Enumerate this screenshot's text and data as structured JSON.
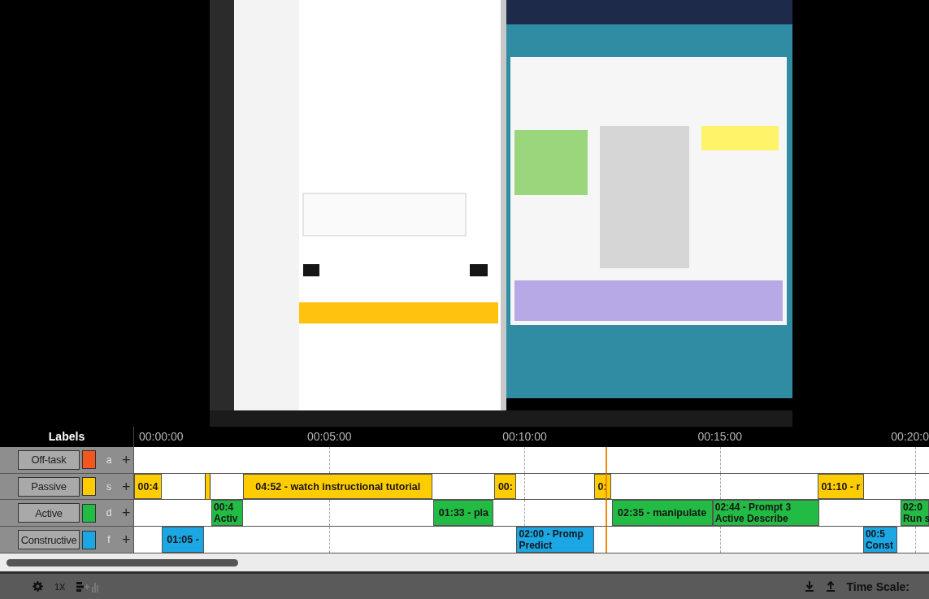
{
  "timeline": {
    "labels_header": "Labels",
    "ticks": [
      "00:00:00",
      "00:05:00",
      "00:10:00",
      "00:15:00",
      "00:20:0"
    ]
  },
  "tracks": [
    {
      "label": "Off-task",
      "color": "#f4561e",
      "key": "a",
      "add": "+"
    },
    {
      "label": "Passive",
      "color": "#ffcc00",
      "key": "s",
      "add": "+",
      "segments": [
        {
          "text": "00:4"
        },
        {
          "kind": "blank"
        },
        {
          "text": "04:52 - watch instructional tutorial"
        },
        {
          "text": "00:"
        },
        {
          "text": "0:"
        },
        {
          "text": "01:10 - r"
        }
      ]
    },
    {
      "label": "Active",
      "color": "#22bb44",
      "key": "d",
      "add": "+",
      "segments": [
        {
          "text": "00:4",
          "text_2": "Activ"
        },
        {
          "text": "01:33 - pla"
        },
        {
          "text": "02:35 - manipulate"
        },
        {
          "text": "02:44 - Prompt 3",
          "text_2": "Active Describe"
        },
        {
          "text": "02:0",
          "text_2": "Run s"
        }
      ]
    },
    {
      "label": "Constructive",
      "color": "#1aa7e4",
      "key": "f",
      "add": "+",
      "segments": [
        {
          "text": "01:05 -"
        },
        {
          "text": "02:00 - Promp",
          "text_2": "Predict"
        },
        {
          "text": "00:5",
          "text_2": "Const"
        }
      ]
    }
  ],
  "controls": {
    "speed": "1X",
    "time_scale_label": "Time Scale:"
  }
}
